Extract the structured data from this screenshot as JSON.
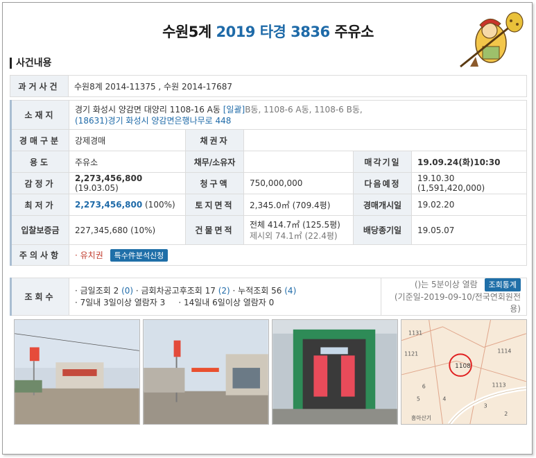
{
  "title": {
    "court": "수원5계",
    "case": "2019 타경 3836",
    "type": "주유소"
  },
  "section": "사건내용",
  "rows": {
    "past_case": {
      "label": "과거사건",
      "value": "수원8계 2014-11375  , 수원 2014-17687"
    },
    "location": {
      "label": "소재지",
      "addr1": "경기 화성시 양감면 대양리 1108-16 A동",
      "bulk": "[일괄]",
      "bulk_rest": "B동, 1108-6 A동, 1108-6 B동,",
      "addr2": "(18631)경기 화성시  양감면은행나무로 448"
    },
    "auction_type": {
      "label": "경매구분",
      "value": "강제경매"
    },
    "creditor": {
      "label": "채권자",
      "value": ""
    },
    "usage": {
      "label": "용도",
      "value": "주유소"
    },
    "debtor": {
      "label": "채무/소유자",
      "value": ""
    },
    "sale_date": {
      "label": "매각기일",
      "value": "19.09.24(화)10:30"
    },
    "appraisal": {
      "label": "감정가",
      "value": "2,273,456,800",
      "extra": "(19.03.05)"
    },
    "claim": {
      "label": "청구액",
      "value": "750,000,000"
    },
    "next_plan": {
      "label": "다음예정",
      "value": "19.10.30 (1,591,420,000)"
    },
    "min_price": {
      "label": "최저가",
      "value": "2,273,456,800",
      "extra": "(100%)"
    },
    "land_area": {
      "label": "토지면적",
      "value": "2,345.0㎡ (709.4평)"
    },
    "start_date": {
      "label": "경매개시일",
      "value": "19.02.20"
    },
    "deposit": {
      "label": "입찰보증금",
      "value": "227,345,680 (10%)"
    },
    "building_area": {
      "label": "건물면적",
      "value1": "전체 414.7㎡ (125.5평)",
      "value2": "제시외 74.1㎡ (22.4평)"
    },
    "dividend_date": {
      "label": "배당종기일",
      "value": "19.05.07"
    },
    "notice": {
      "label": "주의사항",
      "value": "· 유치권",
      "button": "특수件분석신청"
    },
    "views": {
      "label": "조회수",
      "line1_a": "· 금일조회 2 ",
      "line1_a_n": "(0)",
      "line1_b": "  · 금회차공고후조회 17 ",
      "line1_b_n": "(2)",
      "line1_c": "  · 누적조회 56 ",
      "line1_c_n": "(4)",
      "line2": "· 7일내 3일이상 열람자 3     · 14일내 6일이상 열람자 0",
      "note": "()는 5분이상 열람",
      "stats_button": "조회통계",
      "base": "(기준일-2019-09-10/전국연회원전용)"
    }
  },
  "map": {
    "labels": [
      "1108",
      "1114",
      "1113",
      "1121",
      "1131",
      "6",
      "5",
      "4",
      "3",
      "2",
      "흥아산기"
    ]
  },
  "colors": {
    "accent": "#1e6aa8",
    "label_bg": "#edf1f5",
    "button": "#1f6fa8"
  }
}
